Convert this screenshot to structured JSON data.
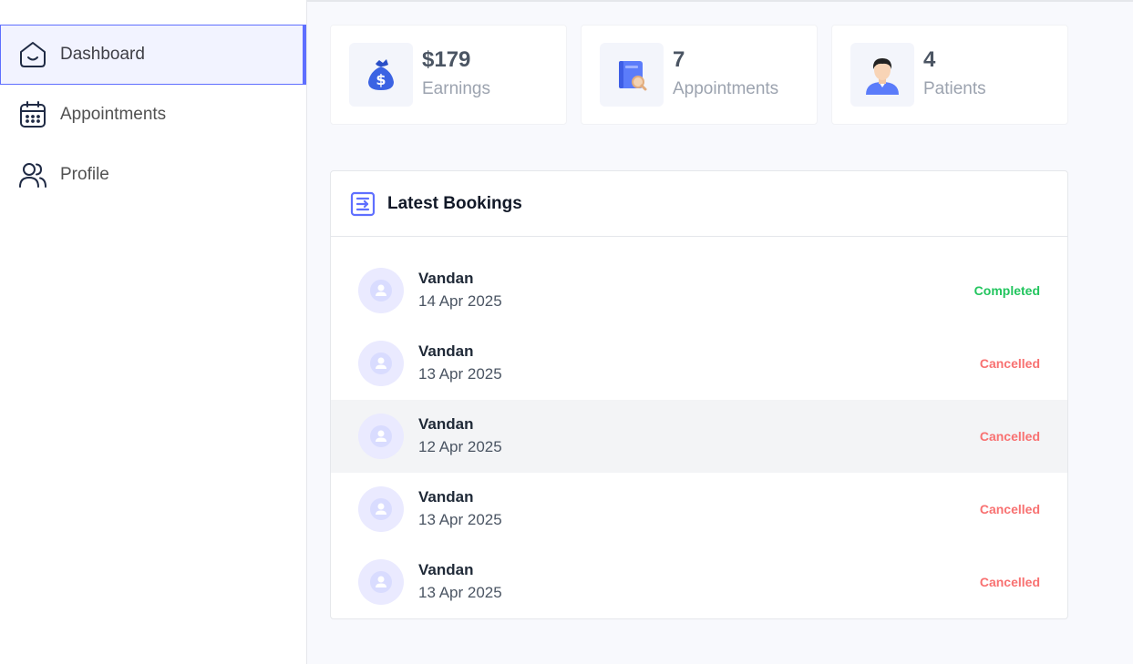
{
  "colors": {
    "primary": "#5f6fff",
    "completed": "#22c55e",
    "cancelled": "#f87171"
  },
  "sidebar": {
    "items": [
      {
        "label": "Dashboard",
        "icon": "home-icon",
        "active": true
      },
      {
        "label": "Appointments",
        "icon": "calendar-icon",
        "active": false
      },
      {
        "label": "Profile",
        "icon": "people-icon",
        "active": false
      }
    ]
  },
  "stats": [
    {
      "value": "$179",
      "label": "Earnings",
      "icon": "money-bag-icon"
    },
    {
      "value": "7",
      "label": "Appointments",
      "icon": "book-search-icon"
    },
    {
      "value": "4",
      "label": "Patients",
      "icon": "patient-icon"
    }
  ],
  "bookings": {
    "title": "Latest Bookings",
    "icon": "list-icon",
    "rows": [
      {
        "name": "Vandan",
        "date": "14 Apr 2025",
        "status": "Completed"
      },
      {
        "name": "Vandan",
        "date": "13 Apr 2025",
        "status": "Cancelled"
      },
      {
        "name": "Vandan",
        "date": "12 Apr 2025",
        "status": "Cancelled"
      },
      {
        "name": "Vandan",
        "date": "13 Apr 2025",
        "status": "Cancelled"
      },
      {
        "name": "Vandan",
        "date": "13 Apr 2025",
        "status": "Cancelled"
      }
    ]
  }
}
